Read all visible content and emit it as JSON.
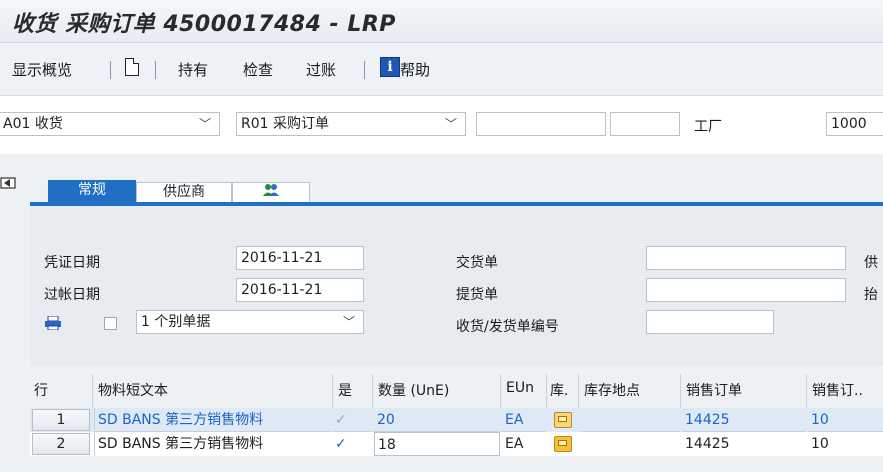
{
  "window": {
    "title": "收货 采购订单 4500017484 - LRP"
  },
  "toolbar": {
    "overview": "显示概览",
    "hold": "持有",
    "check": "检查",
    "post": "过账",
    "help": "帮助",
    "help_icon_glyph": "i"
  },
  "header": {
    "action_value": "A01 收货",
    "ref_doc_value": "R01 采购订单",
    "po_number": "",
    "po_item": "",
    "plant_label": "工厂",
    "plant_value": "1000"
  },
  "tabs": [
    {
      "label": "常规",
      "active": true
    },
    {
      "label": "供应商",
      "active": false
    },
    {
      "label": "",
      "icon": "people-icon"
    }
  ],
  "general": {
    "doc_date_label": "凭证日期",
    "doc_date_value": "2016-11-21",
    "post_date_label": "过帐日期",
    "post_date_value": "2016-11-21",
    "print_mode_value": "1 个别单据",
    "delivery_note_label": "交货单",
    "bill_of_lading_label": "提货单",
    "gr_slip_label": "收货/发货单编号",
    "supplier_trunc_label": "供",
    "header_text_trunc_label": "抬"
  },
  "table": {
    "headers": {
      "line": "行",
      "material_text": "物料短文本",
      "ok": "是",
      "qty": "数量 (UnE)",
      "eun": "EUn",
      "stock_type": "库.",
      "sloc": "库存地点",
      "sales_order": "销售订单",
      "sales_item": "销售订.."
    },
    "rows": [
      {
        "line": "1",
        "text": "SD BANS 第三方销售物料",
        "qty": "20",
        "eun": "EA",
        "sales_order": "14425",
        "sales_item": "10",
        "ok_checked": true,
        "ok_disabled": true
      },
      {
        "line": "2",
        "text": "SD BANS 第三方销售物料",
        "qty": "18",
        "eun": "EA",
        "sales_order": "14425",
        "sales_item": "10",
        "ok_checked": true,
        "ok_disabled": false
      }
    ]
  },
  "colors": {
    "tab_blue": "#1f6fc5",
    "link_blue": "#1a64c8"
  }
}
